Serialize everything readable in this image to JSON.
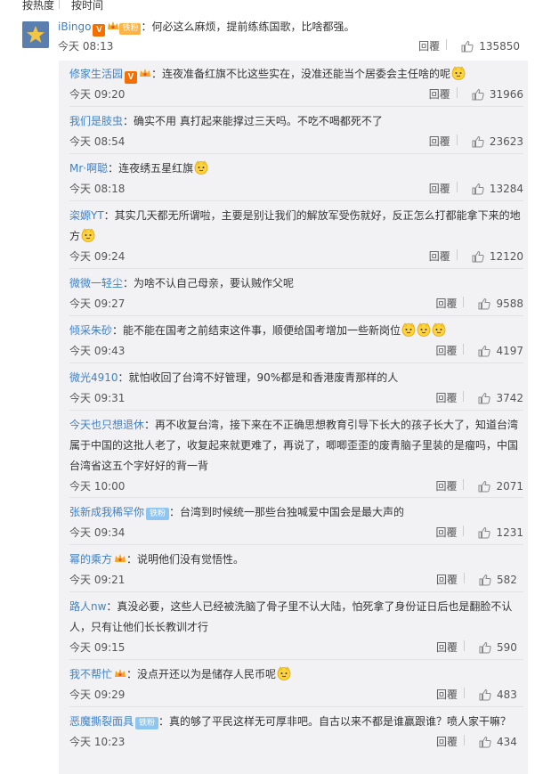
{
  "sort": {
    "hot": "按热度",
    "time": "按时间"
  },
  "main": {
    "user": "iBingo",
    "fan_badge": "铁粉",
    "text": "：何必这么麻烦，提前练练国歌，比啥都强。",
    "time": "今天 08:13",
    "reply_label": "回覆",
    "likes": "135850"
  },
  "replies": [
    {
      "user": "修家生活园",
      "text": "：连夜准备红旗不比这些实在，没准还能当个居委会主任啥的呢",
      "time": "今天 09:20",
      "likes": "31966"
    },
    {
      "user": "我们是肢虫",
      "text": "：确实不用 真打起来能撑过三天吗。不吃不喝都死不了",
      "time": "今天 08:54",
      "likes": "23623"
    },
    {
      "user": "Mr·啊聪",
      "text": "：连夜绣五星红旗",
      "time": "今天 08:18",
      "likes": "13284"
    },
    {
      "user": "栥嫄YT",
      "text": "：其实几天都无所谓啦，主要是别让我们的解放军受伤就好，反正怎么打都能拿下来的地方",
      "time": "今天 09:24",
      "likes": "12120"
    },
    {
      "user": "微微一轻尘",
      "text": "：为啥不认自己母亲，要认贼作父呢",
      "time": "今天 09:27",
      "likes": "9588"
    },
    {
      "user": "倾采朱砂",
      "text": "：能不能在国考之前结束这件事，顺便给国考增加一些新岗位",
      "time": "今天 09:43",
      "likes": "4197"
    },
    {
      "user": "微光4910",
      "text": "：就怕收回了台湾不好管理，90%都是和香港废青那样的人",
      "time": "今天 09:31",
      "likes": "3742"
    },
    {
      "user": "今天也只想退休",
      "text": "：再不收复台湾，接下来在不正确思想教育引导下长大的孩子长大了，知道台湾属于中国的这批人老了，收复起来就更难了，再说了，唧唧歪歪的废青脑子里装的是瘤吗，中国台湾省这五个字好好的背一背",
      "time": "今天 10:00",
      "likes": "2071"
    },
    {
      "user": "张新成我稀罕你",
      "badge": "铁粉",
      "text": "：台湾到时候统一那些台独喊爱中国会是最大声的",
      "time": "今天 09:34",
      "likes": "1231"
    },
    {
      "user": "幂的乘方",
      "text": "：说明他们没有觉悟性。",
      "time": "今天 09:21",
      "likes": "582"
    },
    {
      "user": "路人nw",
      "text": "：真没必要，这些人已经被洗脑了骨子里不认大陆，怕死拿了身份证日后也是翻脸不认人，只有让他们长长教训才行",
      "time": "今天 09:15",
      "likes": "590"
    },
    {
      "user": "我不帮忙",
      "text": "：没点开还以为是储存人民币呢",
      "time": "今天 09:29",
      "likes": "483"
    },
    {
      "user": "恶魔撕裂面具",
      "badge": "铁粉",
      "text": "：真的够了平民这样无可厚非吧。自古以来不都是谁赢跟谁？喷人家干嘛？",
      "time": "今天 10:23",
      "likes": "434"
    }
  ],
  "reply_label": "回覆"
}
